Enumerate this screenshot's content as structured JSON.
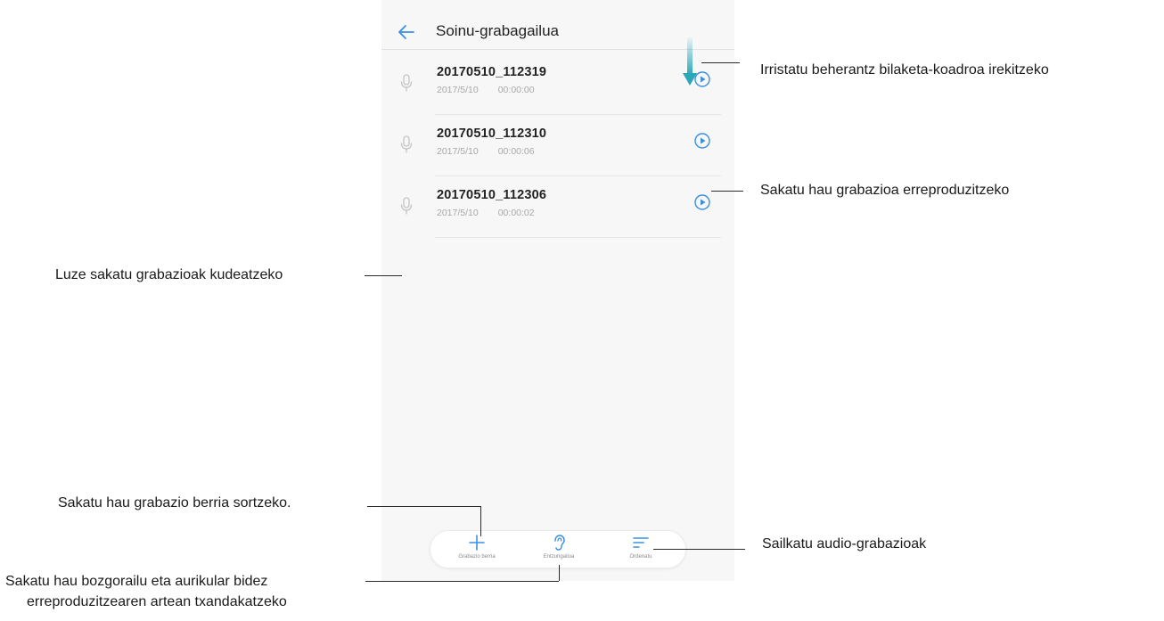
{
  "app": {
    "title": "Soinu-grabagailua"
  },
  "recordings": [
    {
      "name": "20170510_112319",
      "date": "2017/5/10",
      "duration": "00:00:00"
    },
    {
      "name": "20170510_112310",
      "date": "2017/5/10",
      "duration": "00:00:06"
    },
    {
      "name": "20170510_112306",
      "date": "2017/5/10",
      "duration": "00:00:02"
    }
  ],
  "bottom_bar": {
    "new_label": "Grabazio berria",
    "earpiece_label": "Entzungailua",
    "sort_label": "Ordenatu"
  },
  "callouts": {
    "swipe": "Irristatu beherantz bilaketa-koadroa irekitzeko",
    "play": "Sakatu hau grabazioa erreproduzitzeko",
    "long_press": "Luze sakatu grabazioak kudeatzeko",
    "new": "Sakatu hau grabazio berria sortzeko.",
    "sort": "Sailkatu audio-grabazioak",
    "earpiece_line1": "Sakatu hau bozgorailu eta aurikular bidez",
    "earpiece_line2": "erreproduzitzearen artean txandakatzeko"
  },
  "colors": {
    "accent": "#3a8fe0",
    "swipe_arrow": "#2aa8b8",
    "screen_bg": "#f7f7f7"
  },
  "icons": {
    "back": "arrow-left-icon",
    "mic": "microphone-icon",
    "play": "play-circle-icon",
    "new": "plus-icon",
    "earpiece": "ear-icon",
    "sort": "sort-lines-icon",
    "swipe": "down-arrow-icon"
  }
}
